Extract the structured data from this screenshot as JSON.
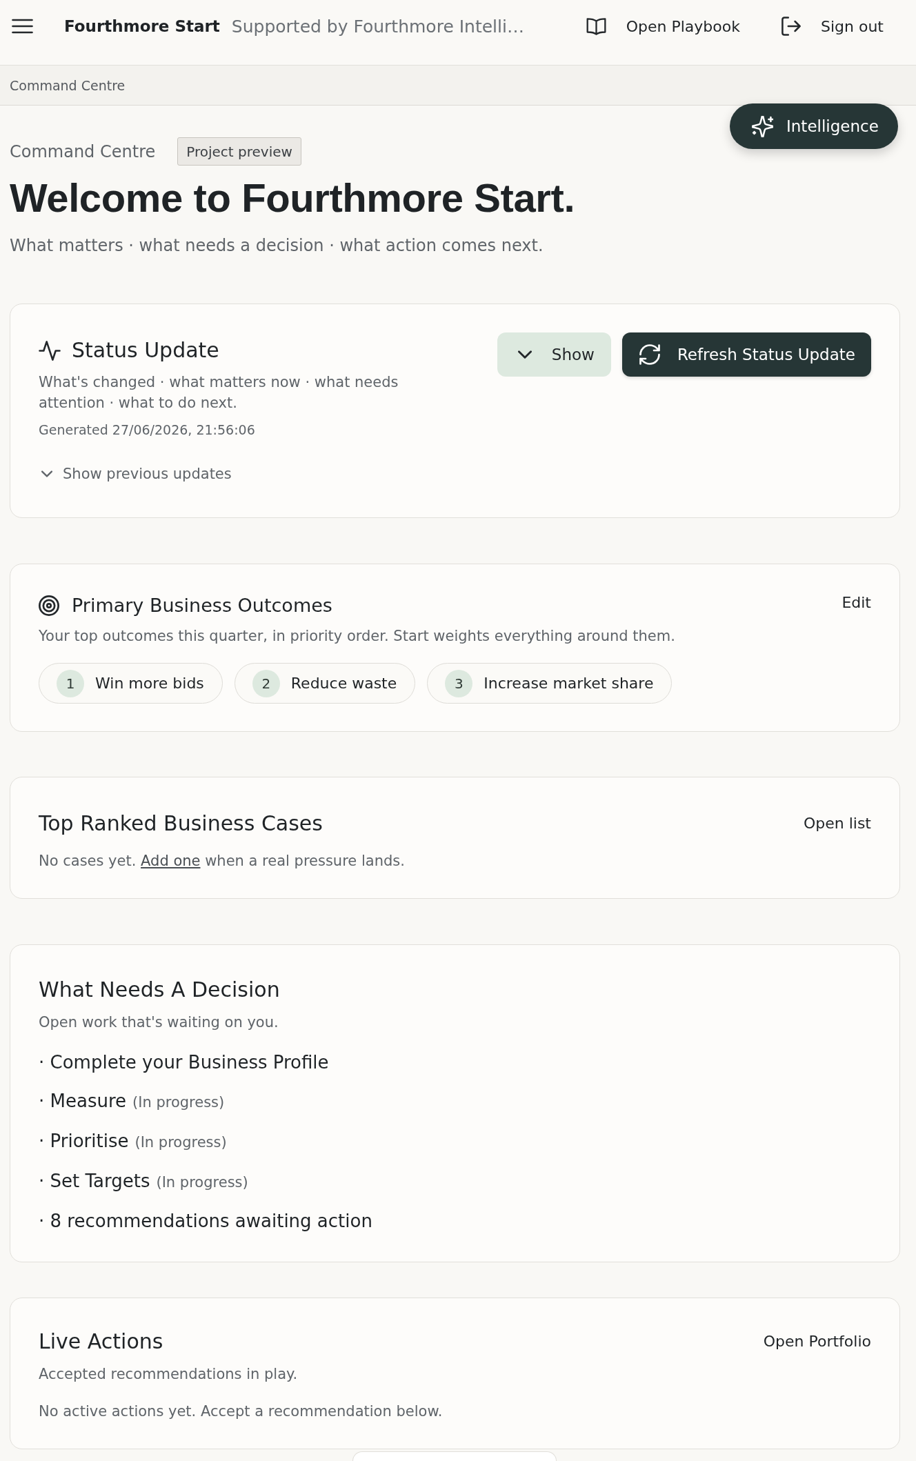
{
  "header": {
    "title": "Fourthmore Start",
    "tagline": "Supported by Fourthmore Intelli…",
    "links": [
      {
        "kind": "playbook",
        "label": "Open Playbook"
      },
      {
        "kind": "signout",
        "label": "Sign out"
      }
    ]
  },
  "breadcrumb": "Command Centre",
  "intelligence_button": {
    "label": "Intelligence"
  },
  "hero": {
    "eyebrow": "Command Centre",
    "badge": "Project preview",
    "title": "Welcome to Fourthmore Start.",
    "subtitle": "What matters · what needs a decision · what action comes next."
  },
  "status_update": {
    "title": "Status Update",
    "description": "What's changed · what matters now · what needs attention · what to do next.",
    "generated": "Generated 27/06/2026, 21:56:06",
    "show_button": {
      "label": "Show",
      "expanded": false
    },
    "refresh_button": {
      "label": "Refresh Status Update"
    },
    "previous_updates": {
      "label": "Show previous updates",
      "expanded": false
    }
  },
  "primary_outcomes": {
    "title": "Primary Business Outcomes",
    "action": "Edit",
    "description": "Your top outcomes this quarter, in priority order. Start weights everything around them.",
    "outcomes": [
      {
        "rank": "1",
        "label": "Win more bids"
      },
      {
        "rank": "2",
        "label": "Reduce waste"
      },
      {
        "rank": "3",
        "label": "Increase market share"
      }
    ]
  },
  "top_cases": {
    "title": "Top Ranked Business Cases",
    "action": "Open list",
    "empty_text": {
      "before": "No cases yet.",
      "link": "Add one",
      "after": "when a real pressure lands."
    }
  },
  "decisions": {
    "title": "What Needs A Decision",
    "description": "Open work that's waiting on you.",
    "items": [
      {
        "label": "· Complete your Business Profile"
      },
      {
        "label": "· Measure",
        "status": "(In progress)"
      },
      {
        "label": "· Prioritise",
        "status": "(In progress)"
      },
      {
        "label": "· Set Targets",
        "status": "(In progress)"
      },
      {
        "label": "· 8 recommendations awaiting action"
      }
    ]
  },
  "live_actions": {
    "title": "Live Actions",
    "action": "Open Portfolio",
    "description": "Accepted recommendations in play.",
    "empty_text": "No active actions yet. Accept a recommendation below."
  }
}
